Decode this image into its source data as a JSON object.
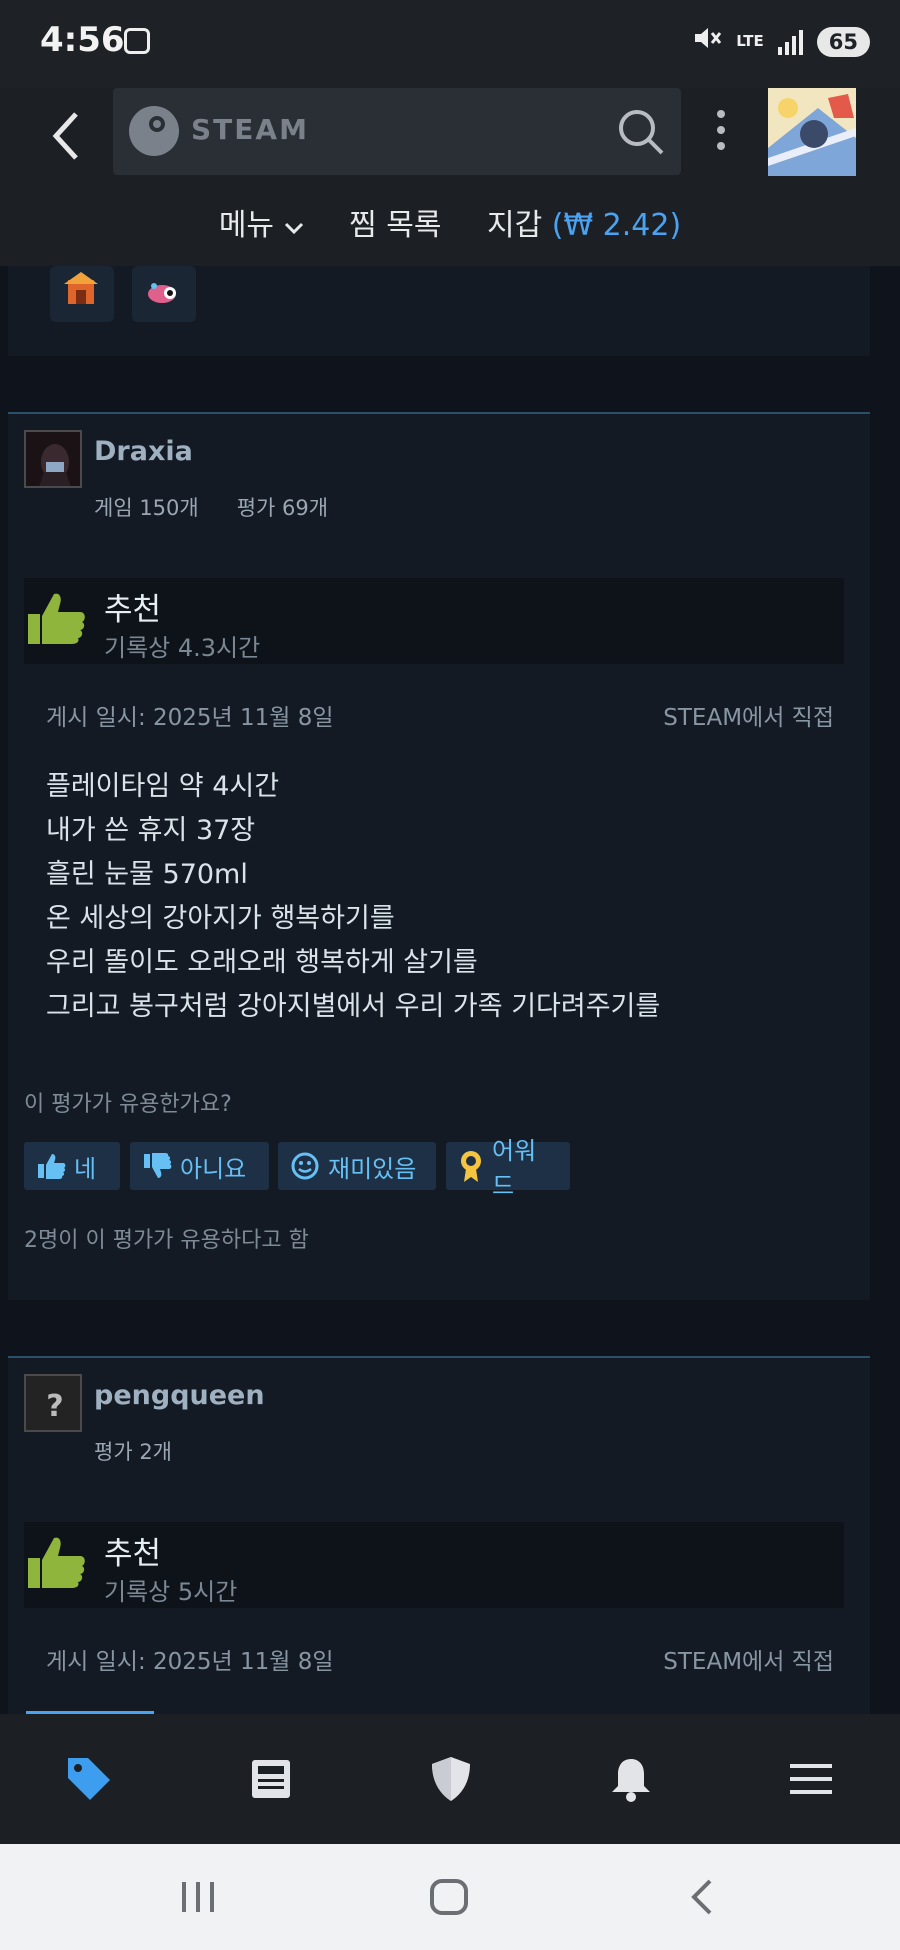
{
  "status_bar": {
    "time": "4:56",
    "network": "LTE",
    "battery": "65"
  },
  "header": {
    "search_brand": "STEAM",
    "nav": {
      "menu": "메뉴",
      "wishlist": "찜 목록",
      "wallet_label": "지갑",
      "wallet_amount": "(₩ 2.42)"
    }
  },
  "reviews": [
    {
      "name": "Draxia",
      "games": "게임 150개",
      "reviews": "평가 69개",
      "verdict": "추천",
      "hours": "기록상 4.3시간",
      "posted": "게시 일시: 2025년 11월 8일",
      "source": "STEAM에서 직접",
      "body": [
        "플레이타임 약 4시간",
        "내가 쓴 휴지 37장",
        "흘린 눈물 570ml",
        "온 세상의 강아지가 행복하기를",
        "우리 똘이도 오래오래 행복하게 살기를",
        "그리고 봉구처럼 강아지별에서 우리 가족 기다려주기를"
      ],
      "helpful_question": "이 평가가 유용한가요?",
      "buttons": {
        "yes": "네",
        "no": "아니요",
        "funny": "재미있음",
        "award": "어워드"
      },
      "helpful_count": "2명이 이 평가가 유용하다고 함"
    },
    {
      "name": "pengqueen",
      "reviews": "평가 2개",
      "verdict": "추천",
      "hours": "기록상 5시간",
      "posted": "게시 일시: 2025년 11월 8일",
      "source": "STEAM에서 직접"
    }
  ],
  "bottom_nav": [
    "store-tag-icon",
    "news-icon",
    "shield-icon",
    "bell-icon",
    "menu-icon"
  ],
  "colors": {
    "accent": "#4aa3f2",
    "thumb": "#8fb53c",
    "background": "#131a24"
  }
}
